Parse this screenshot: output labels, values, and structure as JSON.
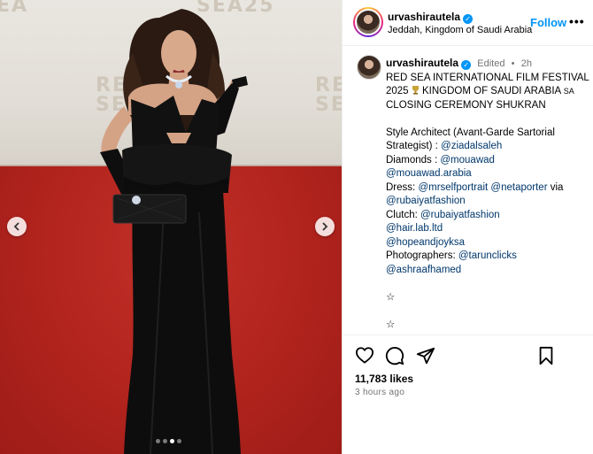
{
  "photo": {
    "wall_text": [
      "EA",
      "SEA25",
      "RE\nSE",
      "RE\nSE"
    ],
    "dots_count": 4,
    "active_dot": 3
  },
  "header": {
    "username": "urvashirautela",
    "location": "Jeddah, Kingdom of Saudi Arabia",
    "follow_label": "Follow",
    "more_label": "•••"
  },
  "caption": {
    "username": "urvashirautela",
    "edited": "Edited",
    "separator": "•",
    "age": "2h",
    "title_line1": "RED SEA INTERNATIONAL FILM FESTIVAL",
    "title_line2a": "2025",
    "title_line2b": "KINGDOM OF SAUDI ARABIA",
    "title_line2c": "SA",
    "title_line3": "CLOSING CEREMONY SHUKRAN",
    "style_label1": "Style Architect (Avant-Garde Sartorial",
    "style_label2": "Strategist) :",
    "style_handle": "@ziadalsaleh",
    "diamonds_label": "Diamonds :",
    "diamonds_handle1": "@mouawad",
    "diamonds_handle2": "@mouawad.arabia",
    "dress_label": "Dress:",
    "dress_handle1": "@mrselfportrait",
    "dress_handle2": "@netaporter",
    "dress_via": "via",
    "dress_handle3": "@rubaiyatfashion",
    "clutch_label": "Clutch:",
    "clutch_handle": "@rubaiyatfashion",
    "hair_handle": "@hair.lab.ltd",
    "hope_handle": "@hopeandjoyksa",
    "photographers_label": "Photographers:",
    "photographers_handle1": "@tarunclicks",
    "photographers_handle2": "@ashraafhamed",
    "star1": "☆",
    "star2": "☆"
  },
  "footer": {
    "likes": "11,783 likes",
    "timestamp": "3 hours ago"
  },
  "colors": {
    "accent": "#0095f6",
    "link": "#00376b",
    "muted": "#737373",
    "carpet": "#b1231d"
  }
}
